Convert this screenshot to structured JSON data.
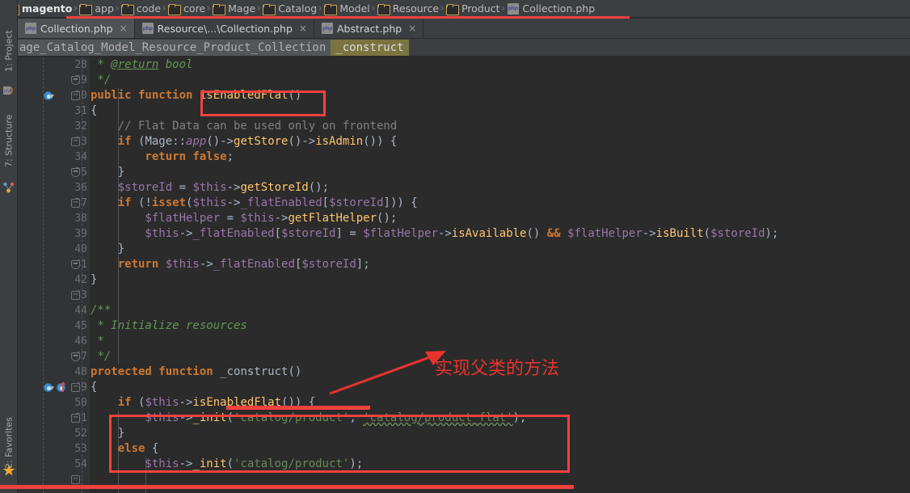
{
  "window": {
    "accent_red": "#f3413f",
    "editor_bg": "#2b2b2b",
    "chrome_bg": "#3c3f41"
  },
  "breadcrumb": {
    "items": [
      {
        "label": "magento",
        "icon": "folder-icon"
      },
      {
        "label": "app",
        "icon": "folder-icon"
      },
      {
        "label": "code",
        "icon": "folder-icon"
      },
      {
        "label": "core",
        "icon": "folder-icon"
      },
      {
        "label": "Mage",
        "icon": "folder-icon"
      },
      {
        "label": "Catalog",
        "icon": "folder-icon"
      },
      {
        "label": "Model",
        "icon": "folder-icon"
      },
      {
        "label": "Resource",
        "icon": "folder-icon"
      },
      {
        "label": "Product",
        "icon": "folder-icon"
      },
      {
        "label": "Collection.php",
        "icon": "php-file-icon"
      }
    ],
    "separator": "›"
  },
  "tabs": [
    {
      "label": "Collection.php",
      "icon": "php-file-icon",
      "close": "×",
      "active": true
    },
    {
      "label": "Resource\\...\\Collection.php",
      "icon": "php-file-icon",
      "close": "×",
      "active": false
    },
    {
      "label": "Abstract.php",
      "icon": "php-file-icon",
      "close": "×",
      "active": false
    }
  ],
  "navbar": {
    "class_path": "age_Catalog_Model_Resource_Product_Collection",
    "member": "_construct"
  },
  "tool_stripe": [
    {
      "label": "1: Project",
      "icon": "project-icon"
    },
    {
      "label": "7: Structure",
      "icon": "structure-icon"
    },
    {
      "label": "2: Favorites",
      "icon": "favorites-star-icon"
    }
  ],
  "editor": {
    "first_line": 28,
    "lines": [
      {
        "n": 28,
        "text": " * @return bool"
      },
      {
        "n": 29,
        "text": " */"
      },
      {
        "n": 30,
        "text": "public function isEnabledFlat()"
      },
      {
        "n": 31,
        "text": "{"
      },
      {
        "n": 32,
        "text": "    // Flat Data can be used only on frontend"
      },
      {
        "n": 33,
        "text": "    if (Mage::app()->getStore()->isAdmin()) {"
      },
      {
        "n": 34,
        "text": "        return false;"
      },
      {
        "n": 35,
        "text": "    }"
      },
      {
        "n": 36,
        "text": "    $storeId = $this->getStoreId();"
      },
      {
        "n": 37,
        "text": "    if (!isset($this->_flatEnabled[$storeId])) {"
      },
      {
        "n": 38,
        "text": "        $flatHelper = $this->getFlatHelper();"
      },
      {
        "n": 39,
        "text": "        $this->_flatEnabled[$storeId] = $flatHelper->isAvailable() && $flatHelper->isBuilt($storeId);"
      },
      {
        "n": 40,
        "text": "    }"
      },
      {
        "n": 41,
        "text": "    return $this->_flatEnabled[$storeId];"
      },
      {
        "n": 42,
        "text": "}"
      },
      {
        "n": 43,
        "text": ""
      },
      {
        "n": 44,
        "text": "/**"
      },
      {
        "n": 45,
        "text": " * Initialize resources"
      },
      {
        "n": 46,
        "text": " *"
      },
      {
        "n": 47,
        "text": " */"
      },
      {
        "n": 48,
        "text": "protected function _construct()"
      },
      {
        "n": 49,
        "text": "{"
      },
      {
        "n": 50,
        "text": "    if ($this->isEnabledFlat()) {"
      },
      {
        "n": 51,
        "text": "        $this->_init('catalog/product', 'catalog/product_flat');"
      },
      {
        "n": 52,
        "text": "    }"
      },
      {
        "n": 53,
        "text": "    else {"
      },
      {
        "n": 54,
        "text": "        $this->_init('catalog/product');"
      }
    ],
    "gutter_icons": [
      {
        "line": 30,
        "icon": "implementing-method-icon"
      },
      {
        "line": 48,
        "icon": "overriding-method-icon"
      },
      {
        "line": 48,
        "icon": "overridden-method-icon"
      }
    ]
  },
  "annotations": {
    "note_cn": "实现父类的方法",
    "highlight_method": "isEnabledFlat()",
    "highlight_block_start_line": 50,
    "highlight_block_end_line": 52
  }
}
